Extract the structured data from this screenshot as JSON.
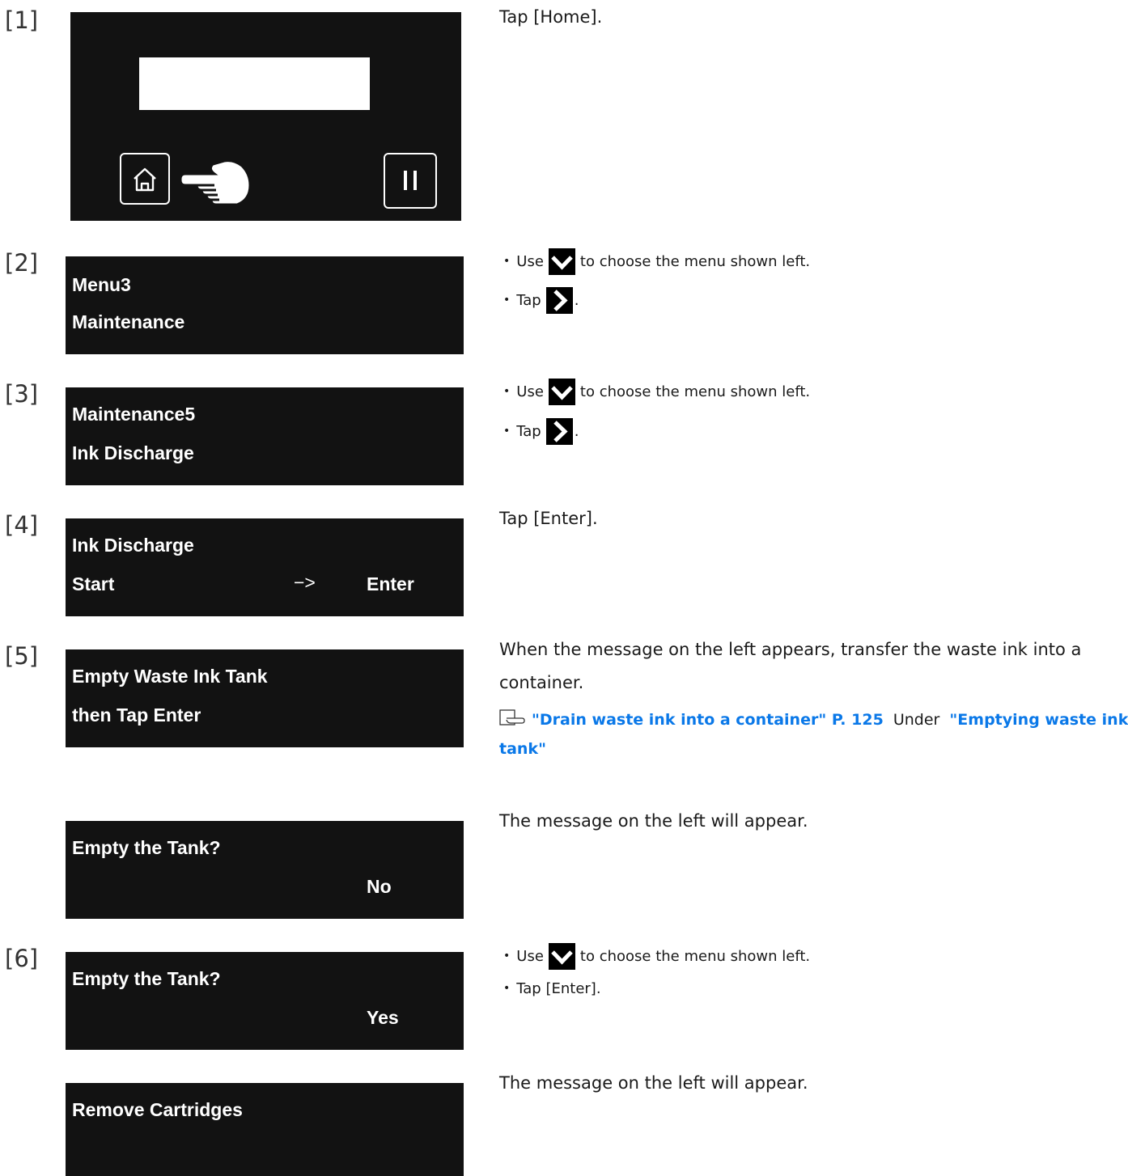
{
  "steps": [
    {
      "number": "[1]",
      "instruction": "Tap [Home]."
    },
    {
      "number": "[2]",
      "lcd": {
        "line1": "Menu3",
        "line2": "Maintenance"
      },
      "bullets": {
        "use_prefix": "Use",
        "use_suffix": "to choose the menu shown left.",
        "tap_prefix": "Tap",
        "tap_suffix": "."
      }
    },
    {
      "number": "[3]",
      "lcd": {
        "line1": "Maintenance5",
        "line2": "Ink Discharge"
      },
      "bullets": {
        "use_prefix": "Use",
        "use_suffix": "to choose the menu shown left.",
        "tap_prefix": "Tap",
        "tap_suffix": "."
      }
    },
    {
      "number": "[4]",
      "lcd": {
        "line1": "Ink Discharge",
        "line2_left": "Start",
        "arrow": "−>",
        "line2_right": "Enter"
      },
      "instruction": "Tap [Enter]."
    },
    {
      "number": "[5]",
      "lcd": {
        "line1": "Empty Waste Ink Tank",
        "line2": "then Tap Enter"
      },
      "instruction_line1": "When the message on the left appears, transfer the waste ink into a",
      "instruction_line2": "container.",
      "reference": {
        "link1": "\"Drain waste ink into a container\" P. 125",
        "middle": "Under",
        "link2_part1": "\"Emptying waste ink",
        "link2_part2": "tank\""
      },
      "followup": {
        "lcd": {
          "line1": "Empty the Tank?",
          "line2": "No"
        },
        "instruction": "The message on the left will appear."
      }
    },
    {
      "number": "[6]",
      "lcd": {
        "line1": "Empty the Tank?",
        "line2": "Yes"
      },
      "bullets": {
        "use_prefix": "Use",
        "use_suffix": "to choose the menu shown left.",
        "tap_enter": "Tap [Enter]."
      },
      "followup": {
        "lcd": {
          "line1": "Remove Cartridges"
        },
        "instruction": "The message on the left will appear."
      }
    }
  ],
  "icons": {
    "home": "home-icon",
    "pause": "pause-icon",
    "pointing_hand": "pointing-hand-icon",
    "down": "chevron-down-icon",
    "right": "chevron-right-icon",
    "reference": "reference-hand-icon"
  },
  "colors": {
    "lcd_background": "#121212",
    "link": "#0a78e8"
  }
}
